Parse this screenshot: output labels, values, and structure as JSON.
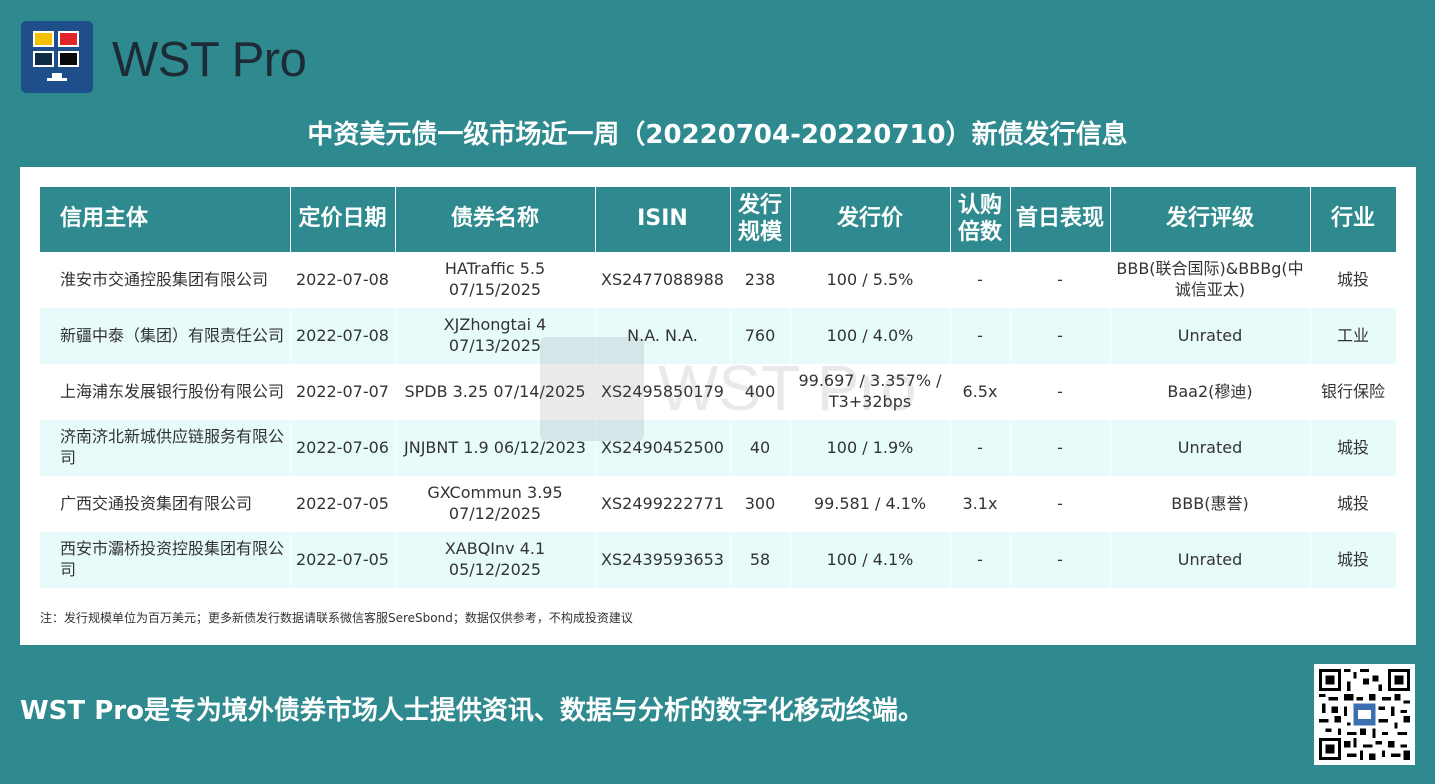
{
  "brand": {
    "name": "WST Pro"
  },
  "title": "中资美元债一级市场近一周（20220704-20220710）新债发行信息",
  "table": {
    "headers": [
      "信用主体",
      "定价日期",
      "债券名称",
      "ISIN",
      "发行规模",
      "发行价",
      "认购倍数",
      "首日表现",
      "发行评级",
      "行业"
    ],
    "rows": [
      [
        "淮安市交通控股集团有限公司",
        "2022-07-08",
        "HATraffic 5.5 07/15/2025",
        "XS2477088988",
        "238",
        "100 / 5.5%",
        "-",
        "-",
        "BBB(联合国际)&BBBg(中诚信亚太)",
        "城投"
      ],
      [
        "新疆中泰（集团）有限责任公司",
        "2022-07-08",
        "XJZhongtai 4 07/13/2025",
        "N.A. N.A.",
        "760",
        "100 / 4.0%",
        "-",
        "-",
        "Unrated",
        "工业"
      ],
      [
        "上海浦东发展银行股份有限公司",
        "2022-07-07",
        "SPDB 3.25 07/14/2025",
        "XS2495850179",
        "400",
        "99.697 / 3.357% / T3+32bps",
        "6.5x",
        "-",
        "Baa2(穆迪)",
        "银行保险"
      ],
      [
        "济南济北新城供应链服务有限公司",
        "2022-07-06",
        "JNJBNT 1.9 06/12/2023",
        "XS2490452500",
        "40",
        "100 / 1.9%",
        "-",
        "-",
        "Unrated",
        "城投"
      ],
      [
        "广西交通投资集团有限公司",
        "2022-07-05",
        "GXCommun 3.95 07/12/2025",
        "XS2499222771",
        "300",
        "99.581 / 4.1%",
        "3.1x",
        "-",
        "BBB(惠誉)",
        "城投"
      ],
      [
        "西安市灞桥投资控股集团有限公司",
        "2022-07-05",
        "XABQInv 4.1 05/12/2025",
        "XS2439593653",
        "58",
        "100 / 4.1%",
        "-",
        "-",
        "Unrated",
        "城投"
      ]
    ]
  },
  "note": "注：发行规模单位为百万美元；更多新债发行数据请联系微信客服SereSbond；数据仅供参考，不构成投资建议",
  "tagline": "WST Pro是专为境外债券市场人士提供资讯、数据与分析的数字化移动终端。",
  "colors": {
    "teal": "#2e8a8e",
    "row_alt": "#e8fbfb",
    "logo_blue": "#1f4f8a"
  }
}
